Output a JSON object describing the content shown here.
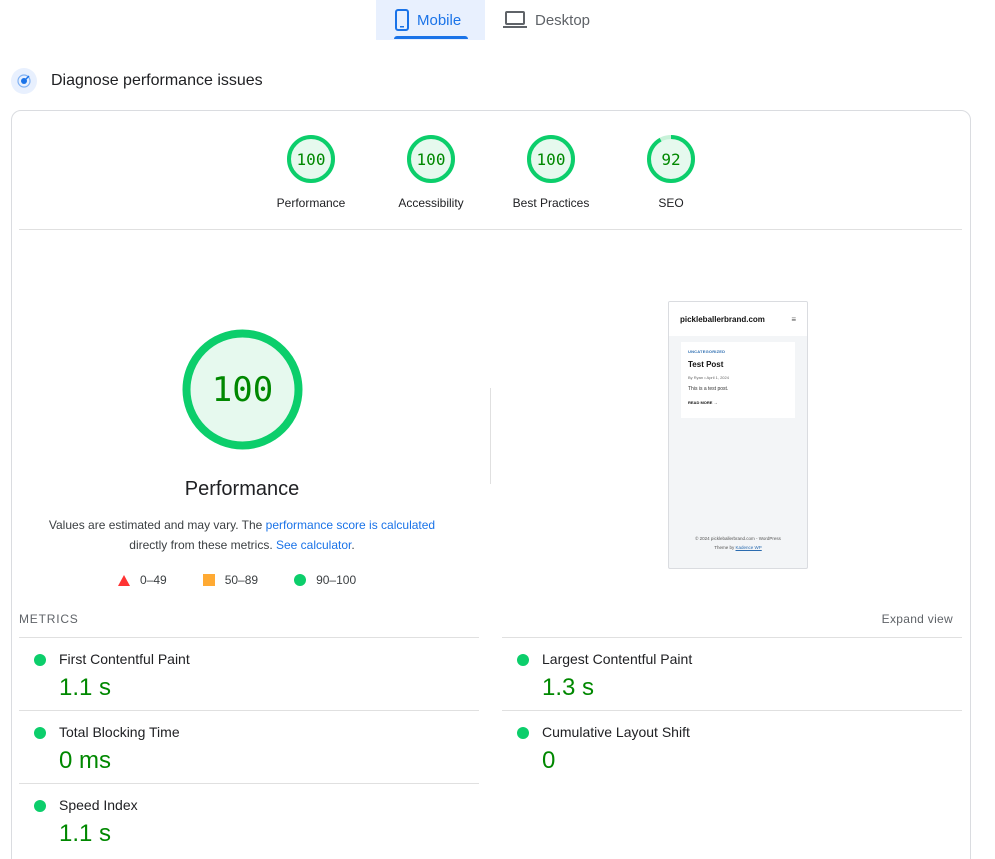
{
  "tabs": [
    {
      "label": "Mobile",
      "icon": "phone-icon",
      "active": true
    },
    {
      "label": "Desktop",
      "icon": "laptop-icon",
      "active": false
    }
  ],
  "diagnose": {
    "title": "Diagnose performance issues",
    "icon": "diagnose-icon"
  },
  "colors": {
    "pass": "#0cce6b",
    "pass_text": "#008800",
    "average": "#ffaa33",
    "fail": "#ff3333",
    "accent": "#1a73e8"
  },
  "scores": [
    {
      "label": "Performance",
      "value": "100",
      "score": 100
    },
    {
      "label": "Accessibility",
      "value": "100",
      "score": 100
    },
    {
      "label": "Best Practices",
      "value": "100",
      "score": 100
    },
    {
      "label": "SEO",
      "value": "92",
      "score": 92
    }
  ],
  "main": {
    "score": "100",
    "title": "Performance",
    "note_part1": "Values are estimated and may vary. The ",
    "note_link1": "performance score is calculated",
    "note_part2": "directly from these metrics. ",
    "note_link2": "See calculator",
    "note_end": "."
  },
  "legend": [
    {
      "shape": "triangle",
      "range": "0–49"
    },
    {
      "shape": "square",
      "range": "50–89"
    },
    {
      "shape": "circle",
      "range": "90–100"
    }
  ],
  "thumbnail": {
    "site": "pickleballerbrand.com",
    "menu_icon": "≡",
    "category": "UNCATEGORIZED",
    "post_title": "Test Post",
    "meta": "By Ryan  •  April 1, 2024",
    "text": "This is a test post.",
    "read_more": "READ MORE →",
    "footer_line1": "© 2024 pickleballerbrand.com - WordPress",
    "footer_line2_prefix": "Theme by ",
    "footer_line2_link": "Kadence WP"
  },
  "metrics": {
    "heading": "METRICS",
    "expand_label": "Expand view",
    "items": [
      {
        "name": "First Contentful Paint",
        "value": "1.1 s"
      },
      {
        "name": "Largest Contentful Paint",
        "value": "1.3 s"
      },
      {
        "name": "Total Blocking Time",
        "value": "0 ms"
      },
      {
        "name": "Cumulative Layout Shift",
        "value": "0"
      },
      {
        "name": "Speed Index",
        "value": "1.1 s"
      }
    ]
  }
}
